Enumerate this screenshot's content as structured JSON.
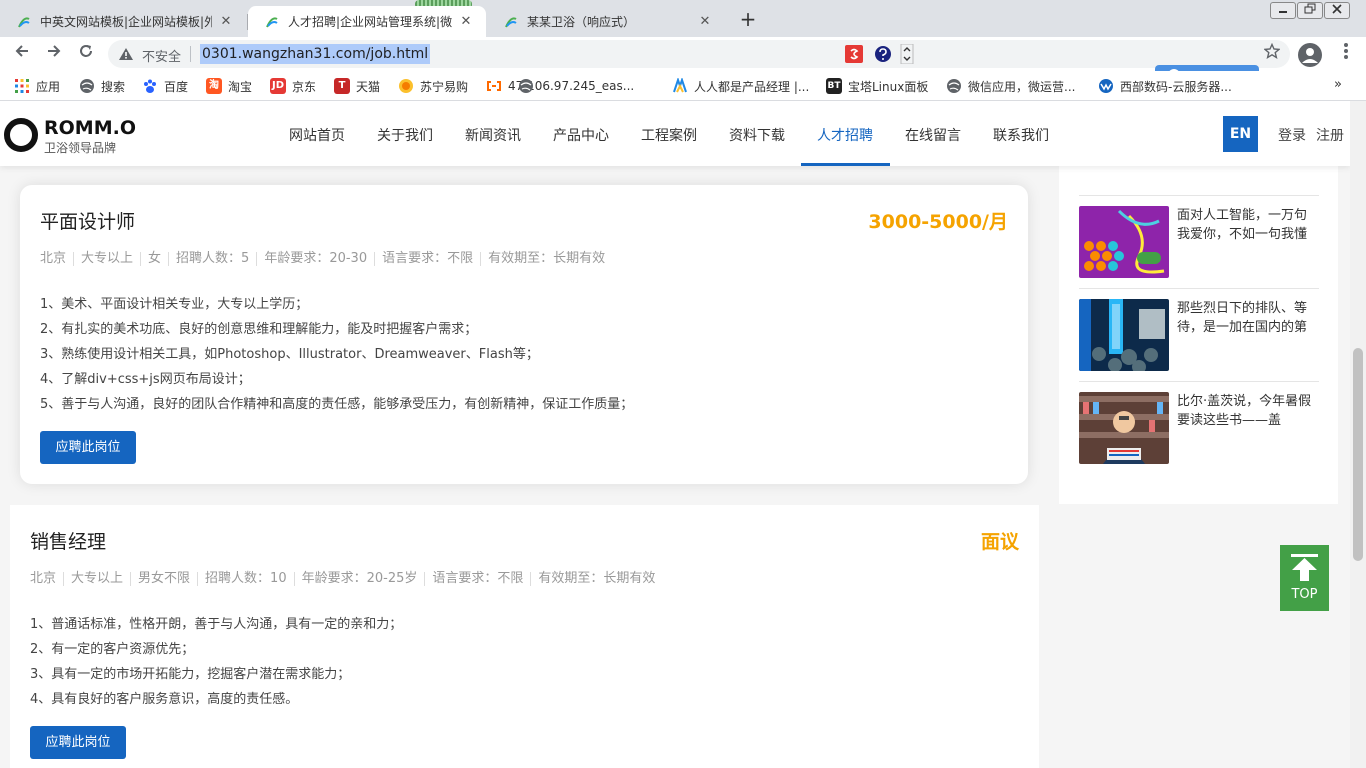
{
  "browser": {
    "tabs": [
      {
        "title": "中英文网站模板|企业网站模板|外",
        "active": false
      },
      {
        "title": "人才招聘|企业网站管理系统|微网",
        "active": true
      },
      {
        "title": "某某卫浴（响应式）",
        "active": false
      }
    ],
    "close_glyph": "✕",
    "new_tab_glyph": "+",
    "address": {
      "security_label": "不安全",
      "url": "0301.wangzhan31.com/job.html"
    },
    "bookmarks": [
      "应用",
      "搜索",
      "百度",
      "淘宝",
      "京东",
      "天猫",
      "苏宁易购",
      "47.106.97.245_eas...",
      "人人都是产品经理 |...",
      "宝塔Linux面板",
      "微信应用，微运营...",
      "西部数码-云服务器..."
    ],
    "bookmarks_more": "»"
  },
  "site": {
    "logo": {
      "title": "ROMM.O",
      "subtitle": "卫浴领导品牌"
    },
    "nav": [
      "网站首页",
      "关于我们",
      "新闻资讯",
      "产品中心",
      "工程案例",
      "资料下载",
      "人才招聘",
      "在线留言",
      "联系我们"
    ],
    "active_nav": "人才招聘",
    "lang_button": "EN",
    "login": "登录",
    "register": "注册"
  },
  "sidebar": {
    "news": [
      {
        "text": ""
      },
      {
        "text": "面对人工智能，一万句我爱你，不如一句我懂"
      },
      {
        "text": "那些烈日下的排队、等待，是一加在国内的第"
      },
      {
        "text": "比尔·盖茨说，今年暑假要读这些书——盖"
      }
    ]
  },
  "jobs": [
    {
      "title": "平面设计师",
      "salary": "3000-5000/月",
      "meta": [
        "北京",
        "大专以上",
        "女",
        "招聘人数：5",
        "年龄要求：20-30",
        "语言要求：不限",
        "有效期至：长期有效"
      ],
      "requirements": [
        "1、美术、平面设计相关专业，大专以上学历；",
        "2、有扎实的美术功底、良好的创意思维和理解能力，能及时把握客户需求；",
        "3、熟练使用设计相关工具，如Photoshop、Illustrator、Dreamweaver、Flash等；",
        "4、了解div+css+js网页布局设计；",
        "5、善于与人沟通，良好的团队合作精神和高度的责任感，能够承受压力，有创新精神，保证工作质量；"
      ],
      "apply_label": "应聘此岗位"
    },
    {
      "title": "销售经理",
      "salary": "面议",
      "meta": [
        "北京",
        "大专以上",
        "男女不限",
        "招聘人数：10",
        "年龄要求：20-25岁",
        "语言要求：不限",
        "有效期至：长期有效"
      ],
      "requirements": [
        "1、普通话标准，性格开朗，善于与人沟通，具有一定的亲和力；",
        "2、有一定的客户资源优先；",
        "3、具有一定的市场开拓能力，挖掘客户潜在需求能力；",
        "4、具有良好的客户服务意识，高度的责任感。"
      ],
      "apply_label": "应聘此岗位"
    }
  ],
  "back_to_top": "TOP",
  "colors": {
    "brand_blue": "#1565c0",
    "salary_orange": "#f5a300",
    "top_green": "#43a047"
  }
}
